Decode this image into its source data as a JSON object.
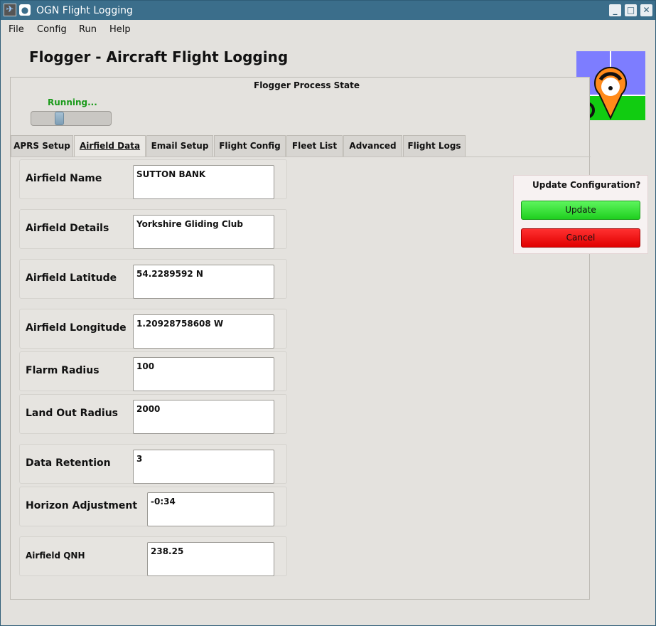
{
  "window": {
    "title": "OGN Flight Logging"
  },
  "menu": {
    "items": [
      "File",
      "Config",
      "Run",
      "Help"
    ]
  },
  "app": {
    "heading": "Flogger - Aircraft Flight Logging"
  },
  "process": {
    "frame_title": "Flogger Process State",
    "status": "Running..."
  },
  "tabs": [
    "APRS Setup",
    "Airfield Data",
    "Email Setup",
    "Flight Config",
    "Fleet List",
    "Advanced",
    "Flight Logs"
  ],
  "active_tab": "Airfield Data",
  "fields": [
    {
      "label": "Airfield Name",
      "value": "SUTTON BANK"
    },
    {
      "label": "Airfield Details",
      "value": "Yorkshire Gliding Club"
    },
    {
      "label": "Airfield Latitude",
      "value": "54.2289592 N"
    },
    {
      "label": "Airfield Longitude",
      "value": "1.20928758608 W"
    },
    {
      "label": "Flarm Radius",
      "value": "100"
    },
    {
      "label": "Land Out Radius",
      "value": "2000"
    },
    {
      "label": "Data Retention",
      "value": "3"
    },
    {
      "label": "Horizon Adjustment",
      "value": "-0:34"
    },
    {
      "label": "Airfield QNH",
      "value": "238.25"
    }
  ],
  "update_panel": {
    "title": "Update Configuration?",
    "update_label": "Update",
    "cancel_label": "Cancel"
  },
  "colors": {
    "titlebar": "#3b6e8b",
    "running": "#1a9a1a",
    "update": "#2fdc2f",
    "cancel": "#f00000"
  }
}
